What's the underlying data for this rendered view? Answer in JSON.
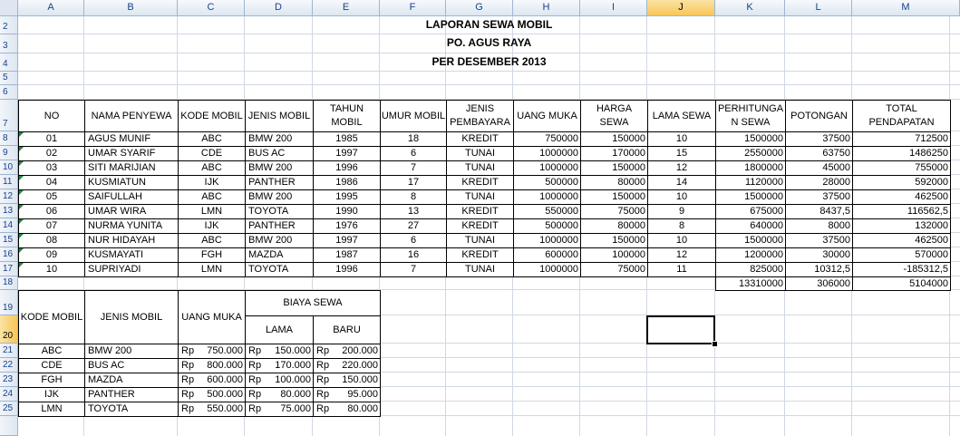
{
  "columns": [
    "A",
    "B",
    "C",
    "D",
    "E",
    "F",
    "G",
    "H",
    "I",
    "J",
    "K",
    "L",
    "M"
  ],
  "rows": [
    "2",
    "3",
    "4",
    "5",
    "6",
    "7",
    "8",
    "9",
    "10",
    "11",
    "12",
    "13",
    "14",
    "15",
    "16",
    "17",
    "18",
    "19",
    "20",
    "21",
    "22",
    "23",
    "24",
    "25"
  ],
  "titles": {
    "line1": "LAPORAN SEWA MOBIL",
    "line2": "PO. AGUS RAYA",
    "line3": "PER DESEMBER 2013"
  },
  "main_headers": [
    "NO",
    "NAMA PENYEWA",
    "KODE MOBIL",
    "JENIS MOBIL",
    "TAHUN MOBIL",
    "UMUR MOBIL",
    "JENIS PEMBAYARA",
    "UANG MUKA",
    "HARGA SEWA",
    "LAMA SEWA",
    "PERHITUNGA N SEWA",
    "POTONGAN",
    "TOTAL PENDAPATAN"
  ],
  "main_rows": [
    [
      "01",
      "AGUS MUNIF",
      "ABC",
      "BMW 200",
      "1985",
      "18",
      "KREDIT",
      "750000",
      "150000",
      "10",
      "1500000",
      "37500",
      "712500"
    ],
    [
      "02",
      "UMAR SYARIF",
      "CDE",
      "BUS AC",
      "1997",
      "6",
      "TUNAI",
      "1000000",
      "170000",
      "15",
      "2550000",
      "63750",
      "1486250"
    ],
    [
      "03",
      "SITI MARIJIAN",
      "ABC",
      "BMW 200",
      "1996",
      "7",
      "TUNAI",
      "1000000",
      "150000",
      "12",
      "1800000",
      "45000",
      "755000"
    ],
    [
      "04",
      "KUSMIATUN",
      "IJK",
      "PANTHER",
      "1986",
      "17",
      "KREDIT",
      "500000",
      "80000",
      "14",
      "1120000",
      "28000",
      "592000"
    ],
    [
      "05",
      "SAIFULLAH",
      "ABC",
      "BMW 200",
      "1995",
      "8",
      "TUNAI",
      "1000000",
      "150000",
      "10",
      "1500000",
      "37500",
      "462500"
    ],
    [
      "06",
      "UMAR WIRA",
      "LMN",
      "TOYOTA",
      "1990",
      "13",
      "KREDIT",
      "550000",
      "75000",
      "9",
      "675000",
      "8437,5",
      "116562,5"
    ],
    [
      "07",
      "NURMA YUNITA",
      "IJK",
      "PANTHER",
      "1976",
      "27",
      "KREDIT",
      "500000",
      "80000",
      "8",
      "640000",
      "8000",
      "132000"
    ],
    [
      "08",
      "NUR HIDAYAH",
      "ABC",
      "BMW 200",
      "1997",
      "6",
      "TUNAI",
      "1000000",
      "150000",
      "10",
      "1500000",
      "37500",
      "462500"
    ],
    [
      "09",
      "KUSMAYATI",
      "FGH",
      "MAZDA",
      "1987",
      "16",
      "KREDIT",
      "600000",
      "100000",
      "12",
      "1200000",
      "30000",
      "570000"
    ],
    [
      "10",
      "SUPRIYADI",
      "LMN",
      "TOYOTA",
      "1996",
      "7",
      "TUNAI",
      "1000000",
      "75000",
      "11",
      "825000",
      "10312,5",
      "-185312,5"
    ]
  ],
  "totals": {
    "sewa": "13310000",
    "potongan": "306000",
    "pendapatan": "5104000"
  },
  "ref_headers": {
    "kode": "KODE MOBIL",
    "jenis": "JENIS MOBIL",
    "uang": "UANG MUKA",
    "biaya": "BIAYA SEWA",
    "lama": "LAMA",
    "baru": "BARU"
  },
  "currency": "Rp",
  "ref_rows": [
    [
      "ABC",
      "BMW 200",
      "750.000",
      "150.000",
      "200.000"
    ],
    [
      "CDE",
      "BUS AC",
      "800.000",
      "170.000",
      "220.000"
    ],
    [
      "FGH",
      "MAZDA",
      "600.000",
      "100.000",
      "150.000"
    ],
    [
      "IJK",
      "PANTHER",
      "500.000",
      "80.000",
      "95.000"
    ],
    [
      "LMN",
      "TOYOTA",
      "550.000",
      "75.000",
      "80.000"
    ]
  ],
  "selected": {
    "column": "J",
    "row": "20"
  }
}
